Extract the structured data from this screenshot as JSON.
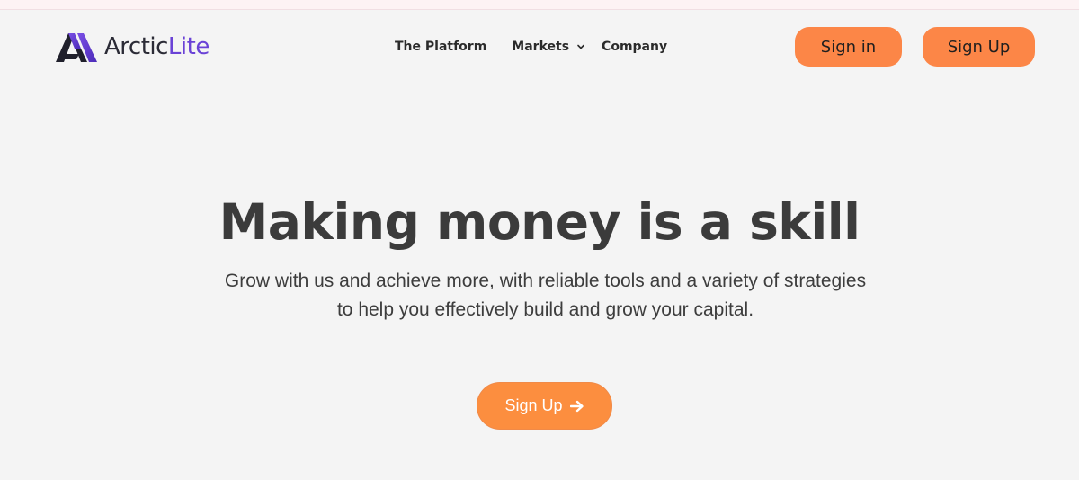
{
  "header": {
    "logo": {
      "text_part1": "Arctic",
      "text_part2": "Lite",
      "accent": "#6a42d6",
      "dark": "#2b2b36"
    },
    "nav": [
      {
        "label": "The Platform"
      },
      {
        "label": "Markets",
        "has_dropdown": true
      },
      {
        "label": "Company"
      }
    ],
    "signin_label": "Sign in",
    "signup_label": "Sign Up"
  },
  "hero": {
    "title": "Making money is a skill",
    "subtitle_line1": "Grow with us and achieve more, with reliable tools and a variety of strategies",
    "subtitle_line2": "to help you effectively build and grow your capital.",
    "cta_label": "Sign Up",
    "cta_icon": "arrow-right-icon"
  },
  "colors": {
    "brand_orange": "#fc8647",
    "background": "#f4f4f4",
    "text": "#3a3a3a"
  }
}
